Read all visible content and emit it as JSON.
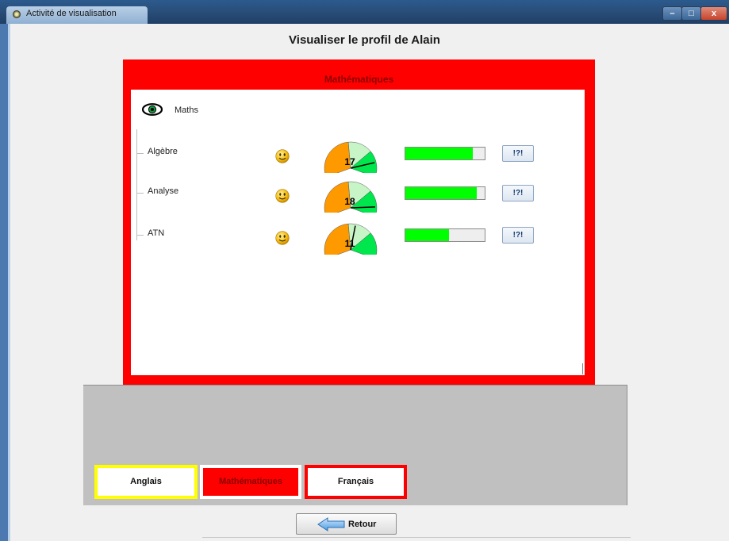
{
  "window": {
    "title": "Activité de visualisation",
    "controls": {
      "minimize": "–",
      "maximize": "□",
      "close": "x"
    }
  },
  "page_title": "Visualiser le profil de Alain",
  "subject_panel": {
    "title": "Mathématiques",
    "root": {
      "icon": "eye-icon",
      "label": "Maths"
    },
    "rows": [
      {
        "label": "Algèbre",
        "icon": "smiley-icon",
        "grade": "17",
        "progress": 0.85,
        "help_label": "!?!"
      },
      {
        "label": "Analyse",
        "icon": "smiley-icon",
        "grade": "18",
        "progress": 0.9,
        "help_label": "!?!"
      },
      {
        "label": "ATN",
        "icon": "smiley-icon",
        "grade": "11",
        "progress": 0.55,
        "help_label": "!?!"
      }
    ]
  },
  "subject_tabs": {
    "anglais": {
      "label": "Anglais",
      "border_color": "#ffff00"
    },
    "maths": {
      "label": "Mathématiques",
      "selected": true,
      "fill_color": "#ff0000"
    },
    "francais": {
      "label": "Français",
      "border_color": "#ff0000"
    }
  },
  "footer": {
    "back_label": "Retour",
    "back_icon": "left-arrow-icon"
  },
  "colors": {
    "panel_accent": "#ff0000",
    "progress_fill": "#00ff00",
    "gauge_orange": "#ff9900",
    "gauge_green": "#00e64d",
    "gauge_light_green": "#c8f5c8"
  }
}
